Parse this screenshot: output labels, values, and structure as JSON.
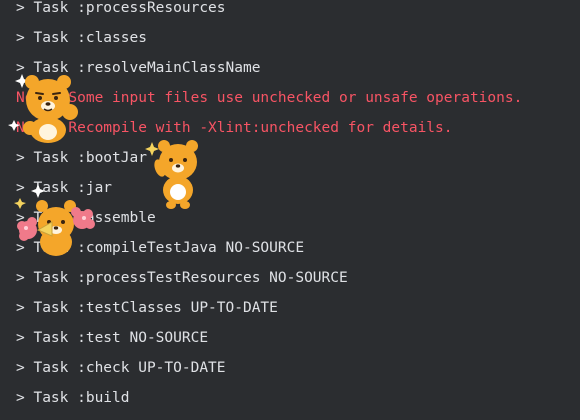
{
  "console": {
    "lines": [
      {
        "text": "> Task :processResources",
        "kind": "normal"
      },
      {
        "text": "> Task :classes",
        "kind": "normal"
      },
      {
        "text": "> Task :resolveMainClassName",
        "kind": "normal"
      },
      {
        "text": "Note: Some input files use unchecked or unsafe operations.",
        "kind": "warn"
      },
      {
        "text": "Note: Recompile with -Xlint:unchecked for details.",
        "kind": "warn"
      },
      {
        "text": "> Task :bootJar",
        "kind": "normal"
      },
      {
        "text": "> Task :jar",
        "kind": "normal"
      },
      {
        "text": "> Task :assemble",
        "kind": "normal"
      },
      {
        "text": "> Task :compileTestJava NO-SOURCE",
        "kind": "normal"
      },
      {
        "text": "> Task :processTestResources NO-SOURCE",
        "kind": "normal"
      },
      {
        "text": "> Task :testClasses UP-TO-DATE",
        "kind": "normal"
      },
      {
        "text": "> Task :test NO-SOURCE",
        "kind": "normal"
      },
      {
        "text": "> Task :check UP-TO-DATE",
        "kind": "normal"
      },
      {
        "text": "> Task :build",
        "kind": "normal"
      }
    ]
  },
  "colors": {
    "background": "#2b2d30",
    "text": "#dfe1e5",
    "warning": "#f75464",
    "sticker_body": "#f4a62a"
  },
  "stickers": [
    {
      "name": "bear-sticker-punch",
      "icon": "bear-icon"
    },
    {
      "name": "bear-sticker-wave",
      "icon": "bear-icon"
    },
    {
      "name": "bear-sticker-cheer",
      "icon": "bear-icon"
    }
  ]
}
